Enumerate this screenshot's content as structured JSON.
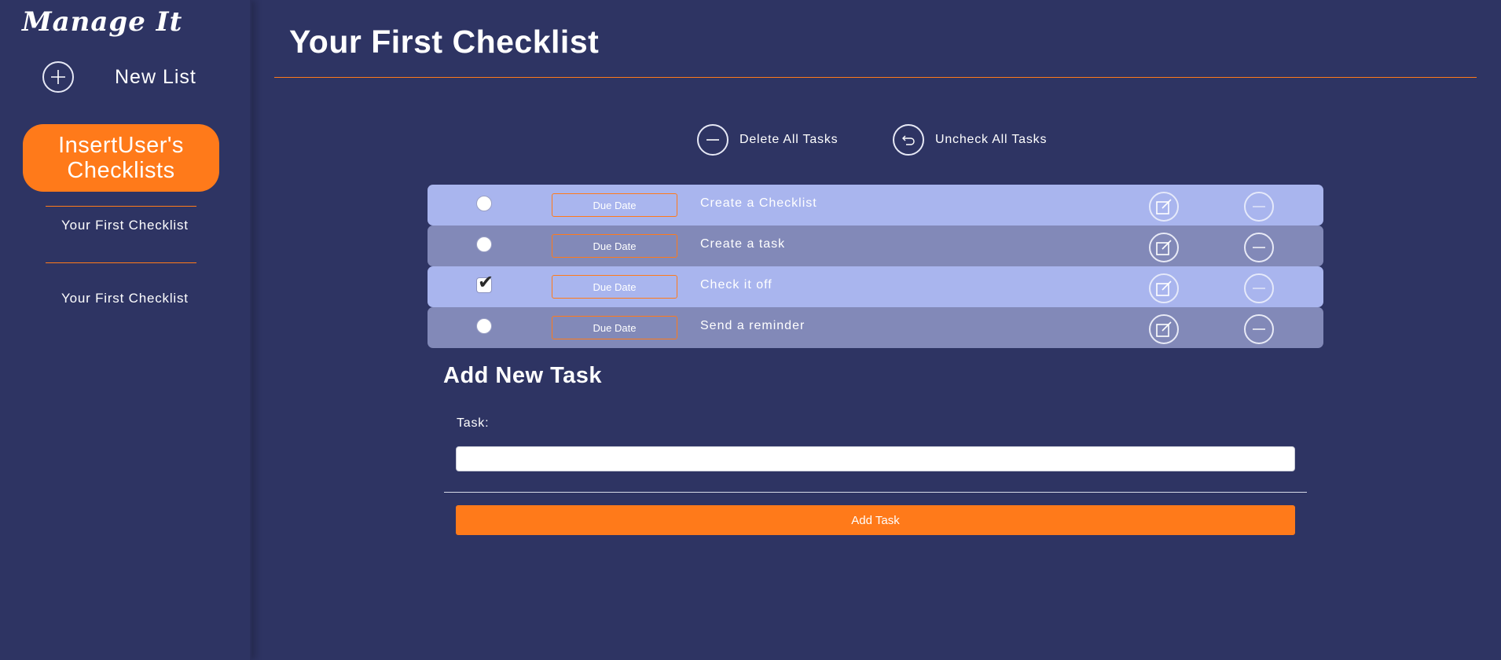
{
  "sidebar": {
    "brand": "Manage It",
    "new_list_label": "New List",
    "user_checklists_label": "InsertUser's Checklists",
    "items": [
      {
        "label": "Your First Checklist"
      },
      {
        "label": "Your First Checklist"
      }
    ]
  },
  "main": {
    "title": "Your First Checklist",
    "actions": {
      "delete_all": "Delete All Tasks",
      "uncheck_all": "Uncheck All Tasks"
    },
    "tasks": [
      {
        "checked": false,
        "due_label": "Due Date",
        "text": "Create a Checklist"
      },
      {
        "checked": false,
        "due_label": "Due Date",
        "text": "Create a task"
      },
      {
        "checked": true,
        "due_label": "Due Date",
        "text": "Check it off"
      },
      {
        "checked": false,
        "due_label": "Due Date",
        "text": "Send a reminder"
      }
    ],
    "add_form": {
      "heading": "Add New Task",
      "task_label": "Task:",
      "task_value": "",
      "submit_label": "Add Task"
    }
  },
  "colors": {
    "background": "#2e3463",
    "accent": "#ff7a1a",
    "row_light": "#a9b5ee",
    "row_dark": "#8289b8"
  }
}
